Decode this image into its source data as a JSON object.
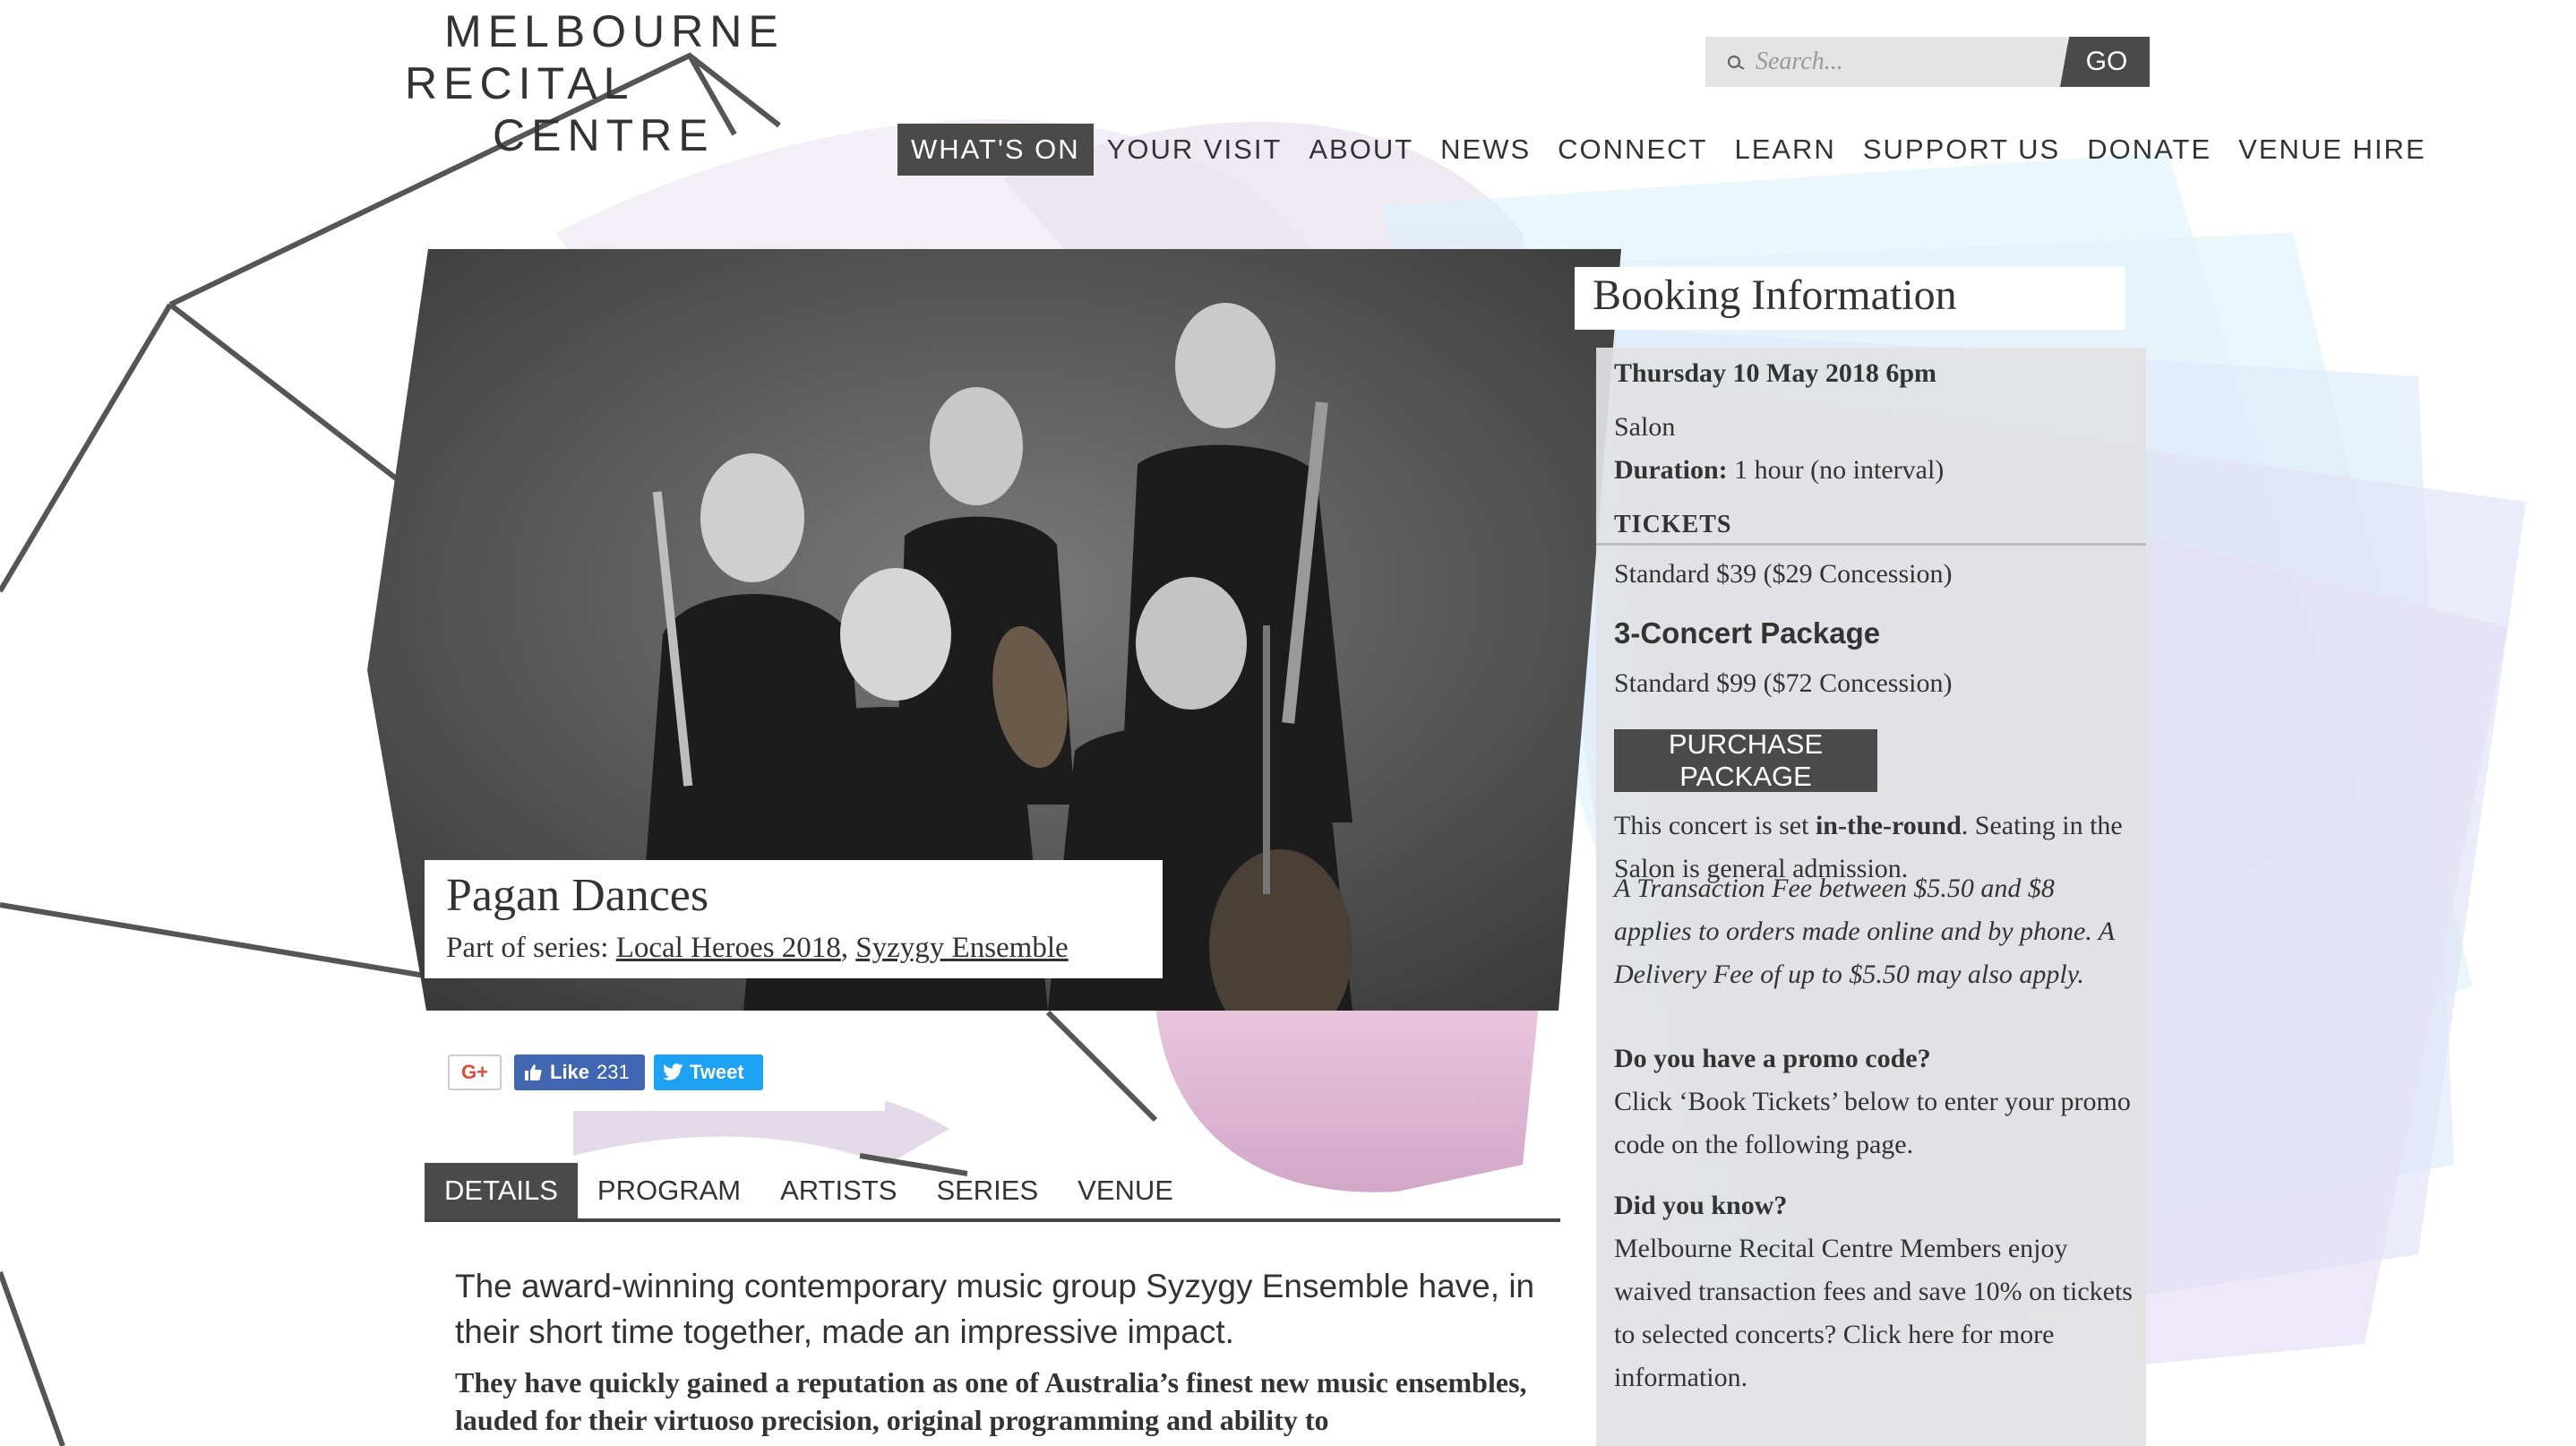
{
  "logo": {
    "line1": "MELBOURNE",
    "line2": "RECITAL",
    "line3": "CENTRE"
  },
  "search": {
    "placeholder": "Search...",
    "go_label": "GO",
    "icon": "search-icon"
  },
  "nav": {
    "items": [
      {
        "label": "WHAT'S ON",
        "active": true
      },
      {
        "label": "YOUR VISIT"
      },
      {
        "label": "ABOUT"
      },
      {
        "label": "NEWS"
      },
      {
        "label": "CONNECT"
      },
      {
        "label": "LEARN"
      },
      {
        "label": "SUPPORT US"
      },
      {
        "label": "DONATE"
      },
      {
        "label": "VENUE HIRE"
      }
    ]
  },
  "event": {
    "title": "Pagan Dances",
    "series_prefix": "Part of series:",
    "series": [
      "Local Heroes 2018",
      "Syzygy Ensemble"
    ],
    "series_sep": ","
  },
  "social": {
    "gplus": "G+",
    "fb_label": "Like",
    "fb_count": "231",
    "tweet_label": "Tweet"
  },
  "tabs": [
    {
      "label": "DETAILS",
      "active": true
    },
    {
      "label": "PROGRAM"
    },
    {
      "label": "ARTISTS"
    },
    {
      "label": "SERIES"
    },
    {
      "label": "VENUE"
    }
  ],
  "body": {
    "intro": "The award-winning contemporary music group Syzygy Ensemble have, in their short time together, made an impressive impact.",
    "bold": "They have quickly gained a reputation as one of Australia’s finest new music ensembles, lauded for their virtuoso precision, original programming and ability to"
  },
  "booking": {
    "heading": "Booking Information",
    "date": "Thursday 10 May 2018 6pm",
    "venue": "Salon",
    "duration_label": "Duration:",
    "duration_value": "1 hour (no interval)",
    "tickets_heading": "TICKETS",
    "standard": "Standard $39 ($29 Concession)",
    "package_heading": "3-Concert Package",
    "package_standard": "Standard $99 ($72 Concession)",
    "purchase_label": "PURCHASE PACKAGE",
    "seating_pre": "This concert is set ",
    "seating_bold": "in-the-round",
    "seating_post": ". Seating in the Salon is general admission.",
    "fee_note": "A Transaction Fee between $5.50 and $8 applies to orders made online and by phone. A Delivery Fee of up to $5.50 may also apply.",
    "promo_heading": "Do you have a promo code?",
    "promo_text": "Click ‘Book Tickets’ below to enter your promo code on the following page.",
    "did_heading": "Did you know?",
    "did_text": "Melbourne Recital Centre Members enjoy waived transaction fees and save 10% on tickets to selected concerts? Click here for more information."
  },
  "colors": {
    "dark": "#4a4a4a",
    "text": "#333333",
    "facebook": "#4267b2",
    "twitter": "#1da1f2",
    "panel": "#e2e2e4"
  }
}
